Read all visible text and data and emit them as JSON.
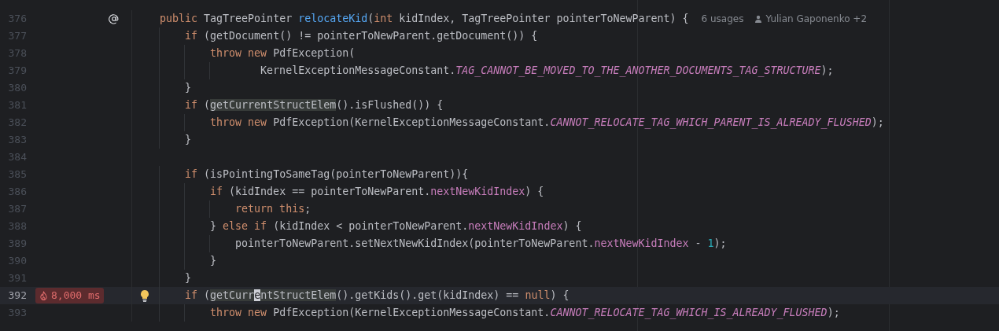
{
  "editor": {
    "lines": [
      {
        "number": "376",
        "current": false,
        "marker": {
          "kind": "annotation"
        },
        "tokens": [
          {
            "kind": "keyword",
            "text": "    public"
          },
          {
            "kind": "plain",
            "text": " TagTreePointer "
          },
          {
            "kind": "declaration",
            "text": "relocateKid"
          },
          {
            "kind": "plain",
            "text": "("
          },
          {
            "kind": "keyword",
            "text": "int"
          },
          {
            "kind": "plain",
            "text": " kidIndex, TagTreePointer pointerToNewParent) {"
          }
        ],
        "hints": {
          "usages": "6 usages",
          "authors": "Yulian Gaponenko +2"
        }
      },
      {
        "number": "377",
        "current": false,
        "tokens": [
          {
            "kind": "keyword",
            "text": "        if"
          },
          {
            "kind": "plain",
            "text": " (getDocument() != pointerToNewParent.getDocument()) {"
          }
        ]
      },
      {
        "number": "378",
        "current": false,
        "tokens": [
          {
            "kind": "keyword",
            "text": "            throw new"
          },
          {
            "kind": "plain",
            "text": " PdfException("
          }
        ]
      },
      {
        "number": "379",
        "current": false,
        "tokens": [
          {
            "kind": "plain",
            "text": "                    KernelExceptionMessageConstant."
          },
          {
            "kind": "constant",
            "text": "TAG_CANNOT_BE_MOVED_TO_THE_ANOTHER_DOCUMENTS_TAG_STRUCTURE"
          },
          {
            "kind": "plain",
            "text": ");"
          }
        ]
      },
      {
        "number": "380",
        "current": false,
        "tokens": [
          {
            "kind": "plain",
            "text": "        }"
          }
        ]
      },
      {
        "number": "381",
        "current": false,
        "tokens": [
          {
            "kind": "keyword",
            "text": "        if"
          },
          {
            "kind": "plain",
            "text": " ("
          },
          {
            "kind": "usage",
            "text": "getCurrentStructElem"
          },
          {
            "kind": "plain",
            "text": "().isFlushed()) {"
          }
        ]
      },
      {
        "number": "382",
        "current": false,
        "tokens": [
          {
            "kind": "keyword",
            "text": "            throw new"
          },
          {
            "kind": "plain",
            "text": " PdfException(KernelExceptionMessageConstant."
          },
          {
            "kind": "constant",
            "text": "CANNOT_RELOCATE_TAG_WHICH_PARENT_IS_ALREADY_FLUSHED"
          },
          {
            "kind": "plain",
            "text": ");"
          }
        ]
      },
      {
        "number": "383",
        "current": false,
        "tokens": [
          {
            "kind": "plain",
            "text": "        }"
          }
        ]
      },
      {
        "number": "384",
        "current": false
      },
      {
        "number": "385",
        "current": false,
        "tokens": [
          {
            "kind": "keyword",
            "text": "        if"
          },
          {
            "kind": "plain",
            "text": " (isPointingToSameTag(pointerToNewParent)){"
          }
        ]
      },
      {
        "number": "386",
        "current": false,
        "tokens": [
          {
            "kind": "keyword",
            "text": "            if"
          },
          {
            "kind": "plain",
            "text": " (kidIndex == pointerToNewParent."
          },
          {
            "kind": "field",
            "text": "nextNewKidIndex"
          },
          {
            "kind": "plain",
            "text": ") {"
          }
        ]
      },
      {
        "number": "387",
        "current": false,
        "tokens": [
          {
            "kind": "keyword",
            "text": "                return this"
          },
          {
            "kind": "plain",
            "text": ";"
          }
        ]
      },
      {
        "number": "388",
        "current": false,
        "tokens": [
          {
            "kind": "plain",
            "text": "            } "
          },
          {
            "kind": "keyword",
            "text": "else if"
          },
          {
            "kind": "plain",
            "text": " (kidIndex < pointerToNewParent."
          },
          {
            "kind": "field",
            "text": "nextNewKidIndex"
          },
          {
            "kind": "plain",
            "text": ") {"
          }
        ]
      },
      {
        "number": "389",
        "current": false,
        "tokens": [
          {
            "kind": "plain",
            "text": "                pointerToNewParent.setNextNewKidIndex(pointerToNewParent."
          },
          {
            "kind": "field",
            "text": "nextNewKidIndex"
          },
          {
            "kind": "plain",
            "text": " - "
          },
          {
            "kind": "number",
            "text": "1"
          },
          {
            "kind": "plain",
            "text": ");"
          }
        ]
      },
      {
        "number": "390",
        "current": false,
        "tokens": [
          {
            "kind": "plain",
            "text": "            }"
          }
        ]
      },
      {
        "number": "391",
        "current": false,
        "tokens": [
          {
            "kind": "plain",
            "text": "        }"
          }
        ]
      },
      {
        "number": "392",
        "current": true,
        "badge": "8,000 ms",
        "marker": {
          "kind": "intention"
        },
        "tokens": [
          {
            "kind": "keyword",
            "text": "        if"
          },
          {
            "kind": "plain",
            "text": " ("
          },
          {
            "kind": "usage",
            "text": "getCurr"
          },
          {
            "kind": "caret",
            "text": "e"
          },
          {
            "kind": "usage",
            "text": "ntStructElem"
          },
          {
            "kind": "plain",
            "text": "().getKids().get(kidIndex) == "
          },
          {
            "kind": "keyword",
            "text": "null"
          },
          {
            "kind": "plain",
            "text": ") {"
          }
        ]
      },
      {
        "number": "393",
        "current": false,
        "tokens": [
          {
            "kind": "keyword",
            "text": "            throw new"
          },
          {
            "kind": "plain",
            "text": " PdfException(KernelExceptionMessageConstant."
          },
          {
            "kind": "constant",
            "text": "CANNOT_RELOCATE_TAG_WHICH_IS_ALREADY_FLUSHED"
          },
          {
            "kind": "plain",
            "text": ");"
          }
        ]
      }
    ]
  }
}
